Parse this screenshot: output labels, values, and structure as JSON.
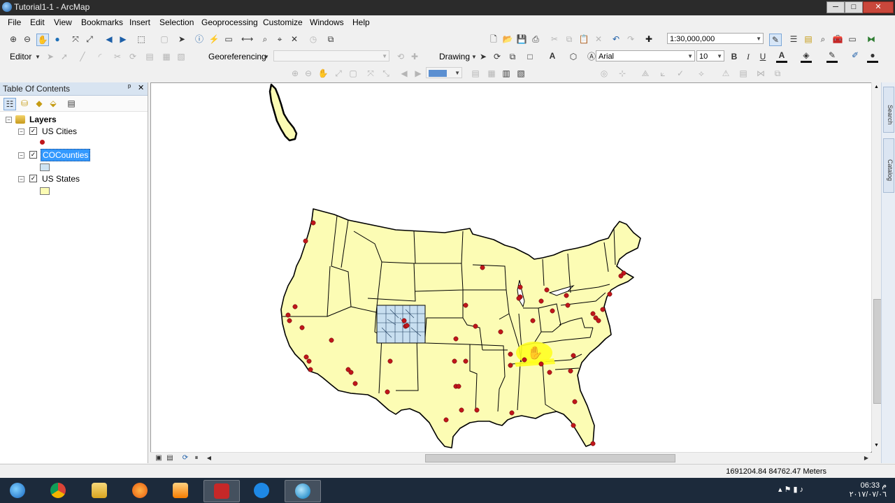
{
  "window": {
    "title": "Tutorial1-1 - ArcMap",
    "minimize": "─",
    "maximize": "□",
    "close": "✕"
  },
  "menu": [
    "File",
    "Edit",
    "View",
    "Bookmarks",
    "Insert",
    "Selection",
    "Geoprocessing",
    "Customize",
    "Windows",
    "Help"
  ],
  "toolbar": {
    "scale_value": "1:30,000,000",
    "editor_label": "Editor",
    "georef_label": "Georeferencing",
    "georef_layer_value": "",
    "drawing_label": "Drawing",
    "font_name": "Arial",
    "font_size": "10",
    "bold": "B",
    "italic": "I",
    "underline": "U",
    "text_tool": "A"
  },
  "toc": {
    "title": "Table Of Contents",
    "pin": "ᵖ",
    "close": "✕",
    "root": "Layers",
    "layers": [
      {
        "name": "US Cities",
        "checked": true,
        "symbol": "point",
        "color": "#c0161b",
        "selected": false
      },
      {
        "name": "COCounties",
        "checked": true,
        "symbol": "polygon",
        "color": "#cfe3f2",
        "selected": true
      },
      {
        "name": "US States",
        "checked": true,
        "symbol": "polygon",
        "color": "#fcfcb4",
        "selected": false
      }
    ]
  },
  "map": {
    "state_fill": "#fcfcb4",
    "county_fill": "#c8dff0",
    "city_color": "#c0161b",
    "highlight_color": "#ffff22",
    "cursor": "hand-pan"
  },
  "dock": {
    "tab1": "Search",
    "tab2": "Catalog"
  },
  "status": {
    "coordinates": "1691204.84  84762.47 Meters"
  },
  "taskbar": {
    "apps": [
      "start-button",
      "chrome",
      "file-explorer",
      "media-app",
      "video-player",
      "acrobat",
      "skype",
      "arcmap"
    ],
    "clock_time": "06:33 م",
    "clock_date": "٢٠١٧/٠٧/٠٦"
  }
}
